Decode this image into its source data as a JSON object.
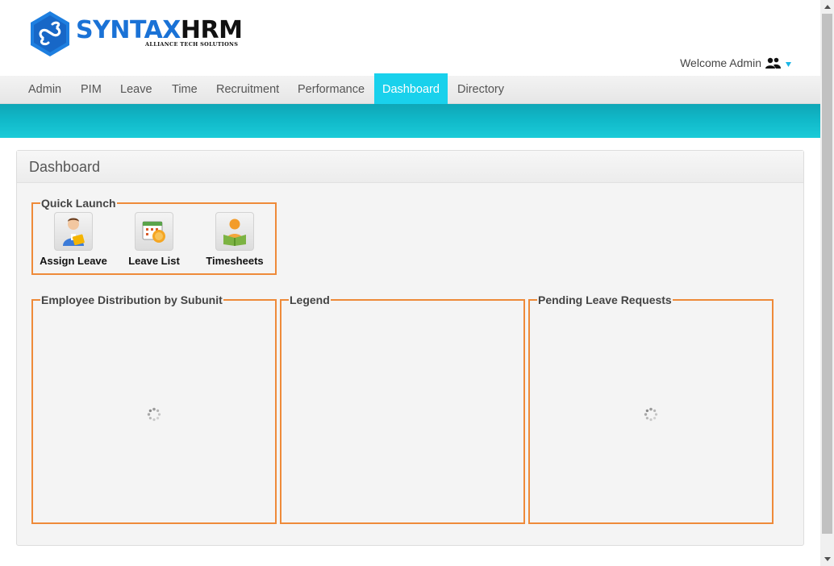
{
  "header": {
    "logo_syntax": "SYNTAX",
    "logo_hrm": "HRM",
    "logo_subtitle": "ALLIANCE TECH SOLUTIONS",
    "welcome_text": "Welcome Admin",
    "user_icon": "user-group-icon",
    "accent_color": "#19d1ec"
  },
  "nav": {
    "items": [
      {
        "label": "Admin"
      },
      {
        "label": "PIM"
      },
      {
        "label": "Leave"
      },
      {
        "label": "Time"
      },
      {
        "label": "Recruitment"
      },
      {
        "label": "Performance"
      },
      {
        "label": "Dashboard"
      },
      {
        "label": "Directory"
      }
    ],
    "active": "Dashboard"
  },
  "panel": {
    "title": "Dashboard",
    "quick_launch": {
      "title": "Quick Launch",
      "items": [
        {
          "label": "Assign Leave",
          "icon": "assign-leave-icon"
        },
        {
          "label": "Leave List",
          "icon": "leave-list-icon"
        },
        {
          "label": "Timesheets",
          "icon": "timesheets-icon"
        }
      ]
    },
    "widgets": [
      {
        "title": "Employee Distribution by Subunit",
        "loading": true
      },
      {
        "title": "Legend",
        "loading": false
      },
      {
        "title": "Pending Leave Requests",
        "loading": true
      }
    ],
    "border_color": "#ee8a39"
  }
}
